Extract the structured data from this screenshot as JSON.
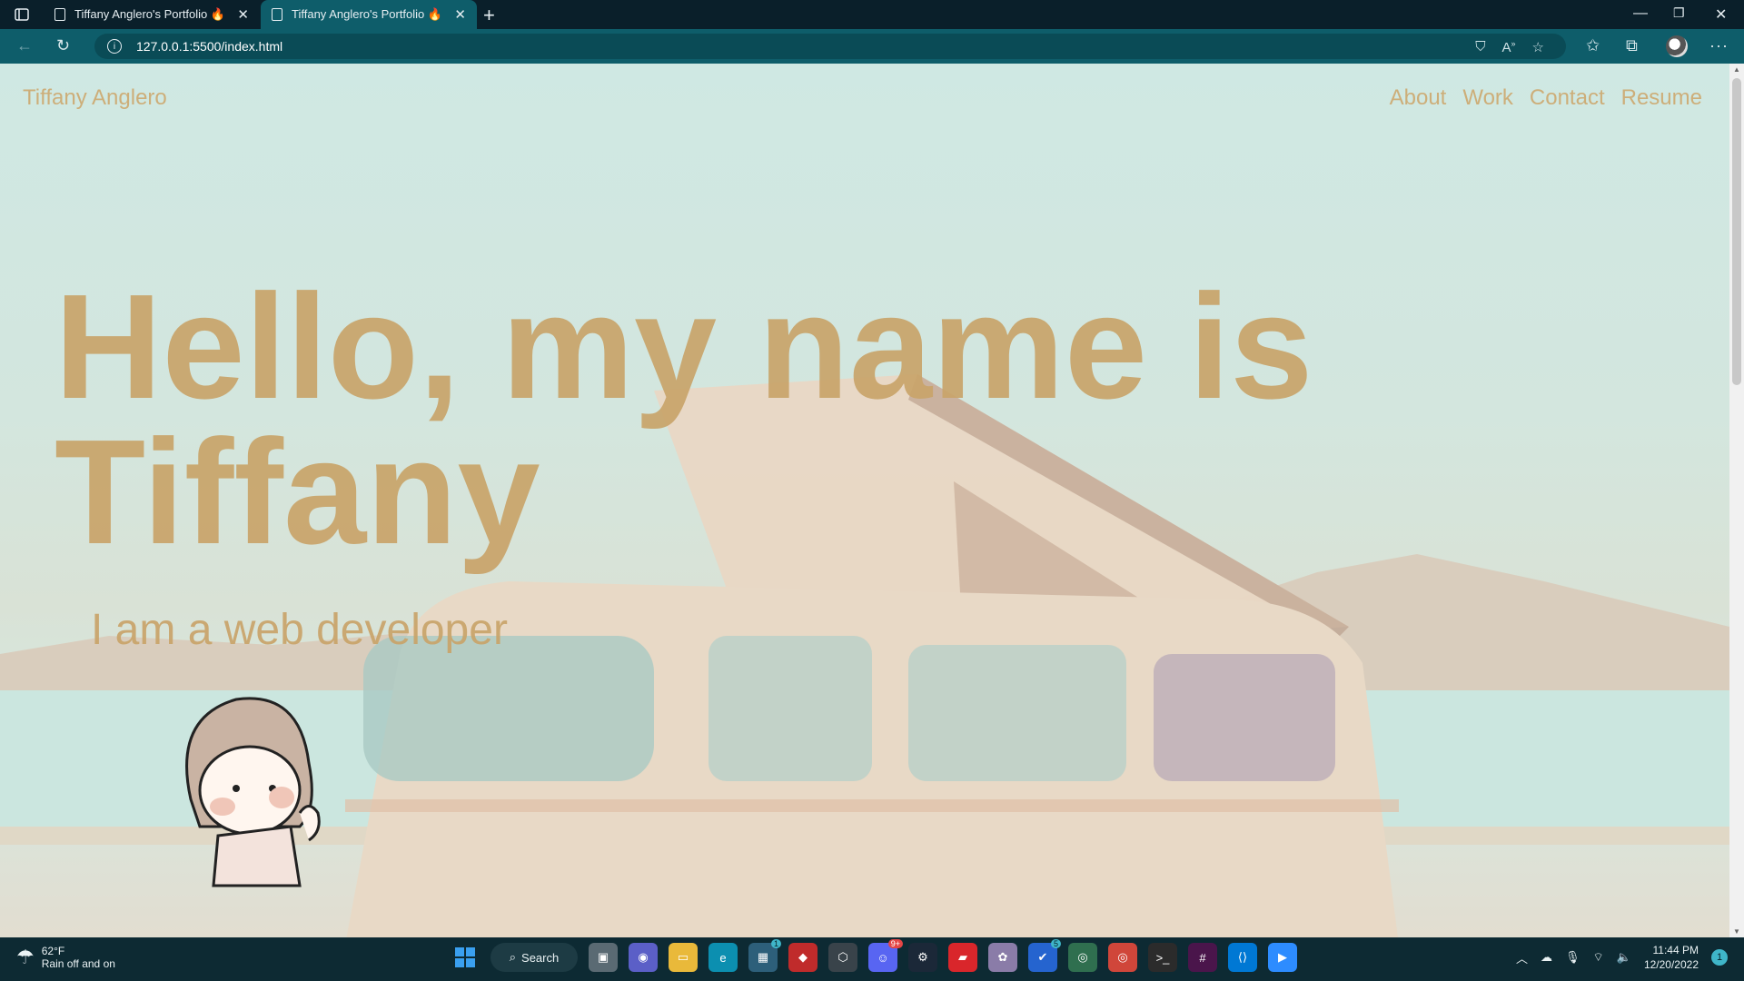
{
  "browser": {
    "tabs": [
      {
        "title": "Tiffany Anglero's Portfolio 🔥"
      },
      {
        "title": "Tiffany Anglero's Portfolio 🔥"
      }
    ],
    "url": "127.0.0.1:5500/index.html"
  },
  "site": {
    "brand": "Tiffany Anglero",
    "nav": [
      "About",
      "Work",
      "Contact",
      "Resume"
    ],
    "hero_line1": "Hello, my name is",
    "hero_line2": "Tiffany",
    "subtitle": "I am a web developer"
  },
  "taskbar": {
    "weather_temp": "62°F",
    "weather_cond": "Rain off and on",
    "search_label": "Search",
    "badges": {
      "store": "1",
      "discord": "9+",
      "todo": "5"
    },
    "time": "11:44 PM",
    "date": "12/20/2022",
    "notifications": "1"
  },
  "colors": {
    "accent": "#c9a46a",
    "browser_teal": "#0e5d6a",
    "taskbar": "#0d2a33"
  }
}
